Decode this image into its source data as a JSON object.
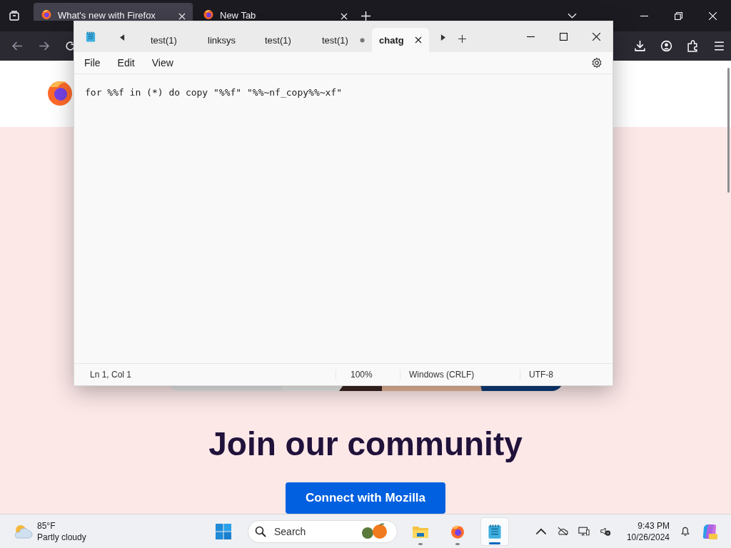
{
  "browser": {
    "tabs": [
      {
        "title": "What's new with Firefox",
        "selected": true
      },
      {
        "title": "New Tab",
        "selected": false
      }
    ],
    "page": {
      "heading": "Join our community",
      "button": "Connect with Mozilla"
    }
  },
  "notepad": {
    "tabs": [
      {
        "label": "test(1)",
        "selected": false,
        "unsaved": false
      },
      {
        "label": "linksys",
        "selected": false,
        "unsaved": false
      },
      {
        "label": "test(1)",
        "selected": false,
        "unsaved": false
      },
      {
        "label": "test(1)",
        "selected": false,
        "unsaved": true
      },
      {
        "label": "chatg",
        "selected": true,
        "unsaved": false
      }
    ],
    "menu": [
      "File",
      "Edit",
      "View"
    ],
    "text": "for %%f in (*) do copy \"%%f\" \"%%~nf_copy%%~xf\"",
    "status": {
      "position": "Ln 1, Col 1",
      "zoom": "100%",
      "line_ending": "Windows (CRLF)",
      "encoding": "UTF-8"
    }
  },
  "taskbar": {
    "weather": {
      "temperature": "85°F",
      "condition": "Partly cloudy"
    },
    "search": {
      "placeholder": "Search"
    },
    "apps": [
      {
        "kind": "explorer",
        "selected": false
      },
      {
        "kind": "firefox",
        "selected": false
      },
      {
        "kind": "notepad",
        "selected": true
      }
    ],
    "time": "9:43 PM",
    "date": "10/26/2024"
  }
}
